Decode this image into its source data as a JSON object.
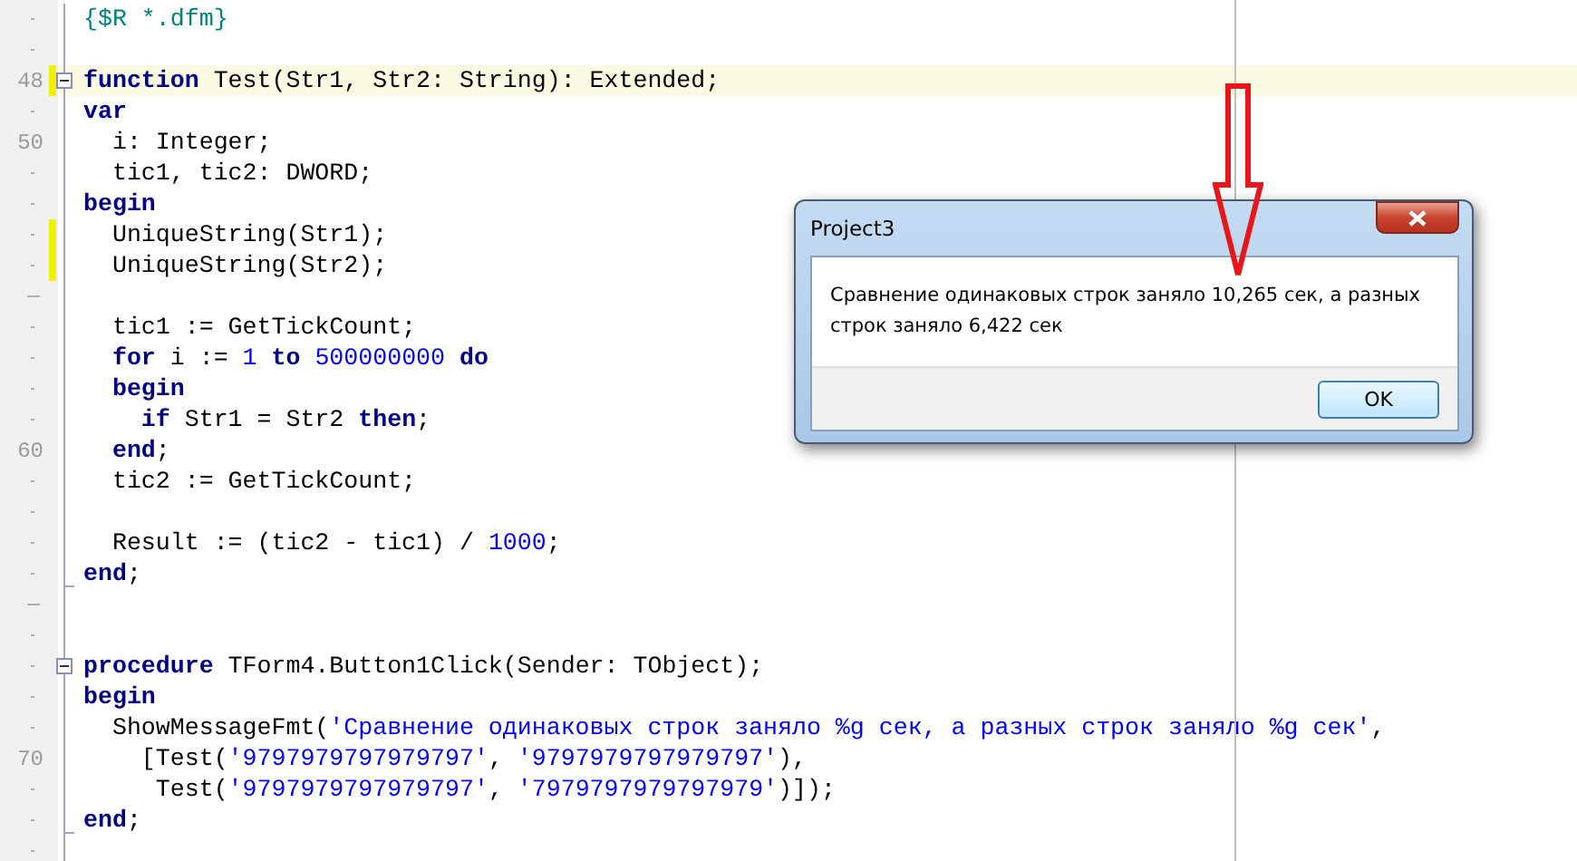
{
  "editor": {
    "lines": [
      {
        "kind": "dot",
        "changed": false,
        "current": false,
        "tokens": [
          {
            "text": "{$R *.dfm}",
            "kind": "comment"
          }
        ]
      },
      {
        "kind": "dot",
        "changed": false,
        "current": false
      },
      {
        "kind": "numbered",
        "number": "48",
        "changed": true,
        "current": true,
        "tokens": [
          {
            "text": "function",
            "kind": "keyword"
          },
          {
            "text": " Test(Str1, Str2: String): Extended;",
            "kind": "plain"
          }
        ],
        "children": [
          {
            "kind": "dot",
            "changed": false,
            "current": false,
            "tokens": [
              {
                "text": "var",
                "kind": "keyword"
              }
            ]
          },
          {
            "kind": "numbered",
            "number": "50",
            "changed": false,
            "current": false,
            "tokens": [
              {
                "text": "  i: Integer;",
                "kind": "plain"
              }
            ]
          },
          {
            "kind": "dot",
            "changed": false,
            "current": false,
            "tokens": [
              {
                "text": "  tic1, tic2: DWORD;",
                "kind": "plain"
              }
            ]
          },
          {
            "kind": "dot",
            "changed": false,
            "current": false,
            "tokens": [
              {
                "text": "begin",
                "kind": "keyword"
              }
            ]
          },
          {
            "kind": "dot",
            "changed": true,
            "current": false,
            "tokens": [
              {
                "text": "  UniqueString(Str1);",
                "kind": "plain"
              }
            ]
          },
          {
            "kind": "dot",
            "changed": true,
            "current": false,
            "tokens": [
              {
                "text": "  UniqueString(Str2);",
                "kind": "plain"
              }
            ]
          },
          {
            "kind": "dash",
            "changed": false,
            "current": false
          },
          {
            "kind": "dot",
            "changed": false,
            "current": false,
            "tokens": [
              {
                "text": "  tic1 := GetTickCount;",
                "kind": "plain"
              }
            ]
          },
          {
            "kind": "dot",
            "changed": false,
            "current": false,
            "tokens": [
              {
                "text": "  for",
                "kind": "keyword"
              },
              {
                "text": " i := ",
                "kind": "plain"
              },
              {
                "text": "1",
                "kind": "number"
              },
              {
                "text": " to ",
                "kind": "keyword"
              },
              {
                "text": "500000000",
                "kind": "number"
              },
              {
                "text": " do",
                "kind": "keyword"
              }
            ]
          },
          {
            "kind": "dot",
            "changed": false,
            "current": false,
            "tokens": [
              {
                "text": "  begin",
                "kind": "keyword"
              }
            ]
          },
          {
            "kind": "dot",
            "changed": false,
            "current": false,
            "tokens": [
              {
                "text": "    if",
                "kind": "keyword"
              },
              {
                "text": " Str1 = Str2 ",
                "kind": "plain"
              },
              {
                "text": "then",
                "kind": "keyword"
              },
              {
                "text": ";",
                "kind": "plain"
              }
            ]
          },
          {
            "kind": "numbered",
            "number": "60",
            "changed": false,
            "current": false,
            "tokens": [
              {
                "text": "  end",
                "kind": "keyword"
              },
              {
                "text": ";",
                "kind": "plain"
              }
            ]
          },
          {
            "kind": "dot",
            "changed": false,
            "current": false,
            "tokens": [
              {
                "text": "  tic2 := GetTickCount;",
                "kind": "plain"
              }
            ]
          },
          {
            "kind": "dot",
            "changed": false,
            "current": false
          },
          {
            "kind": "dot",
            "changed": false,
            "current": false,
            "tokens": [
              {
                "text": "  Result := (tic2 - tic1) / ",
                "kind": "plain"
              },
              {
                "text": "1000",
                "kind": "number"
              },
              {
                "text": ";",
                "kind": "plain"
              }
            ]
          },
          {
            "kind": "dot",
            "changed": false,
            "current": false,
            "tokens": [
              {
                "text": "end",
                "kind": "keyword"
              },
              {
                "text": ";",
                "kind": "plain"
              }
            ]
          }
        ]
      },
      {
        "kind": "dash",
        "changed": false,
        "current": false
      },
      {
        "kind": "dot",
        "changed": false,
        "current": false
      },
      {
        "kind": "dot",
        "changed": false,
        "current": false,
        "tokens": [
          {
            "text": "procedure",
            "kind": "keyword"
          },
          {
            "text": " TForm4.Button1Click(Sender: TObject);",
            "kind": "plain"
          }
        ],
        "children": [
          {
            "kind": "dot",
            "changed": false,
            "current": false,
            "tokens": [
              {
                "text": "begin",
                "kind": "keyword"
              }
            ]
          },
          {
            "kind": "dot",
            "changed": false,
            "current": false,
            "tokens": [
              {
                "text": "  ShowMessageFmt(",
                "kind": "plain"
              },
              {
                "text": "'Сравнение одинаковых строк заняло %g сек, а разных строк заняло %g сек'",
                "kind": "string"
              },
              {
                "text": ",",
                "kind": "plain"
              }
            ]
          },
          {
            "kind": "numbered",
            "number": "70",
            "changed": false,
            "current": false,
            "tokens": [
              {
                "text": "    [Test(",
                "kind": "plain"
              },
              {
                "text": "'9797979797979797'",
                "kind": "string"
              },
              {
                "text": ", ",
                "kind": "plain"
              },
              {
                "text": "'9797979797979797'",
                "kind": "string"
              },
              {
                "text": "),",
                "kind": "plain"
              }
            ]
          },
          {
            "kind": "dot",
            "changed": false,
            "current": false,
            "tokens": [
              {
                "text": "     Test(",
                "kind": "plain"
              },
              {
                "text": "'9797979797979797'",
                "kind": "string"
              },
              {
                "text": ", ",
                "kind": "plain"
              },
              {
                "text": "'7979797979797979'",
                "kind": "string"
              },
              {
                "text": ")]);",
                "kind": "plain"
              }
            ]
          },
          {
            "kind": "dot",
            "changed": false,
            "current": false,
            "tokens": [
              {
                "text": "end",
                "kind": "keyword"
              },
              {
                "text": ";",
                "kind": "plain"
              }
            ]
          }
        ]
      },
      {
        "kind": "dot",
        "changed": false,
        "current": false
      }
    ]
  },
  "dialog": {
    "title": "Project3",
    "message": "Сравнение одинаковых строк заняло 10,265 сек, а разных строк заняло 6,422 сек",
    "button": "OK"
  }
}
